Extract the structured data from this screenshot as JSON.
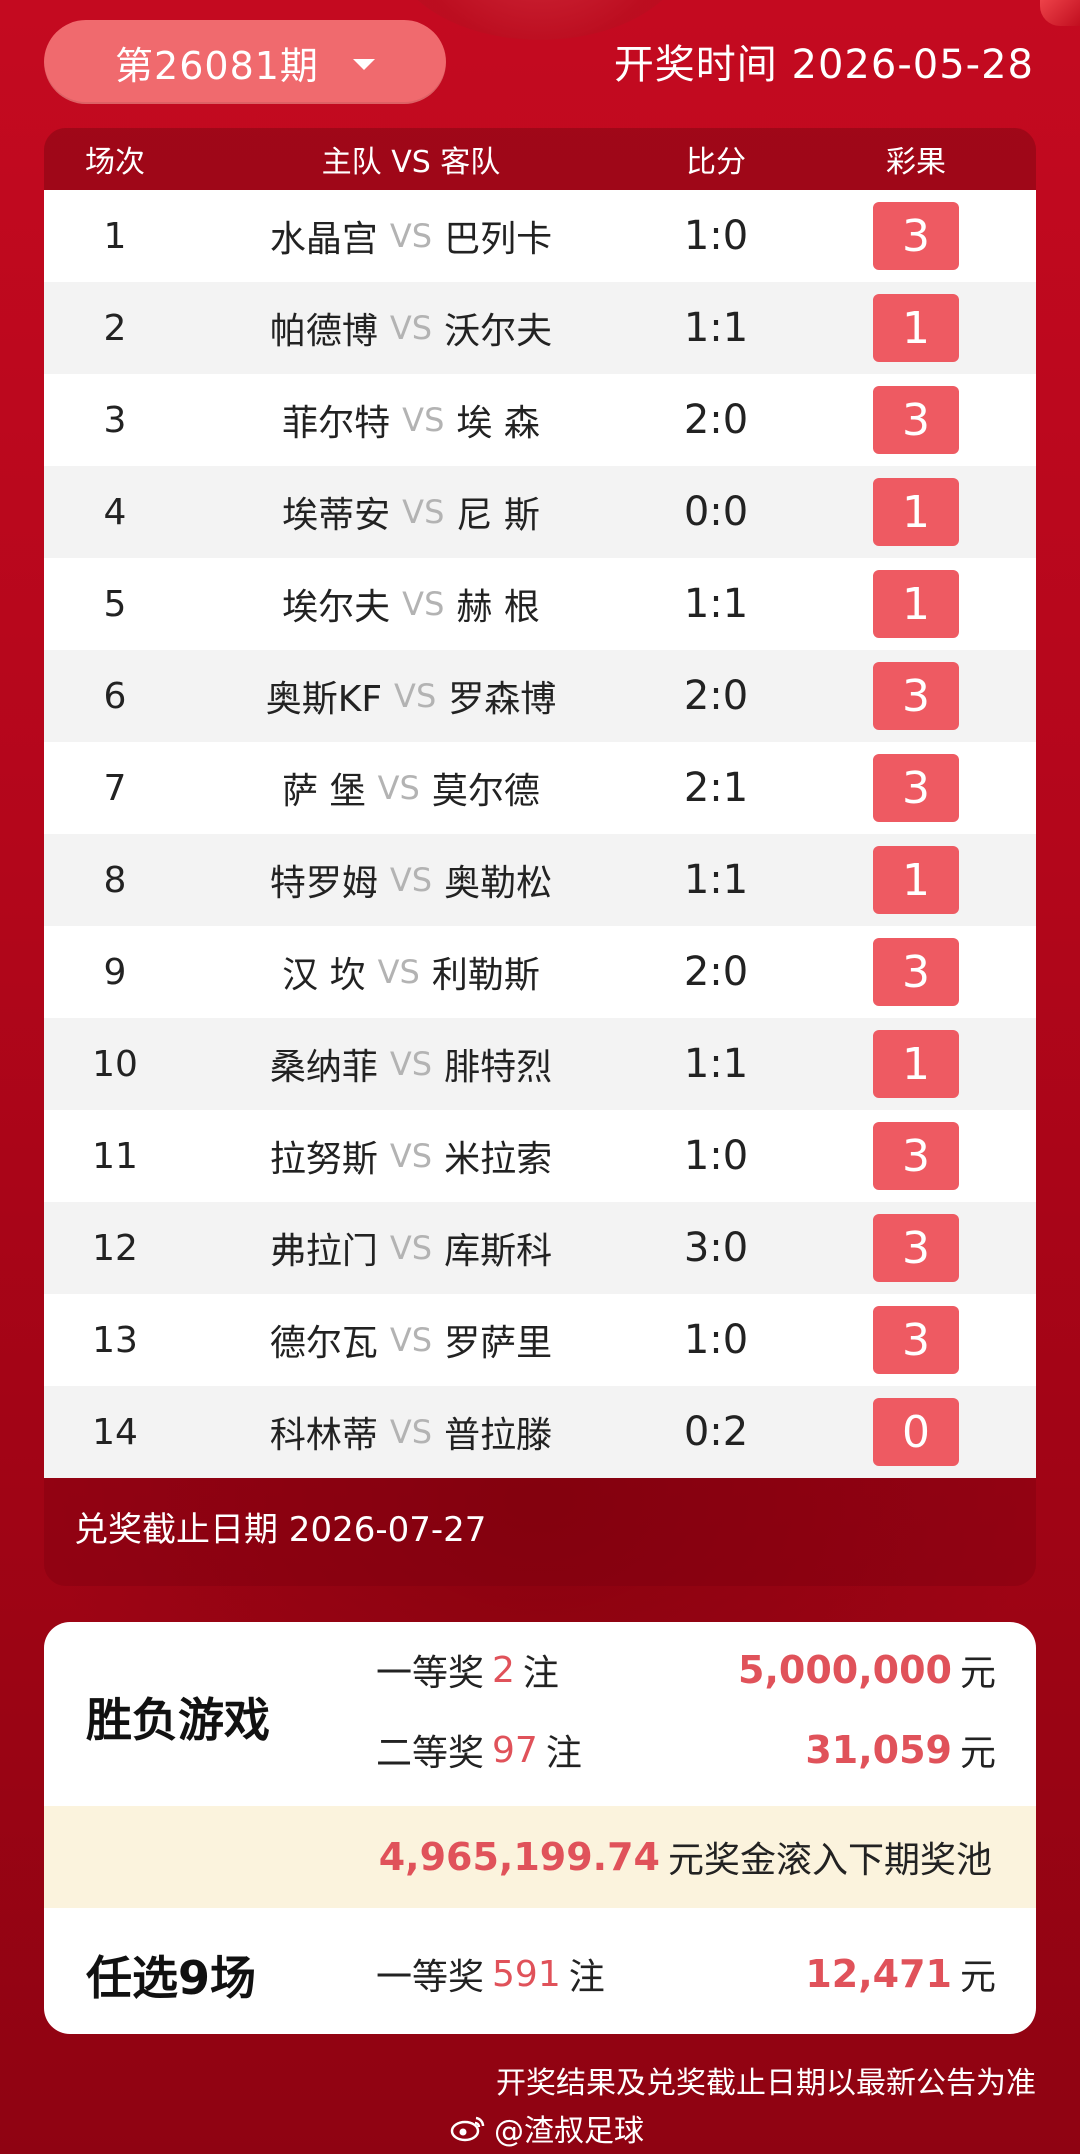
{
  "header": {
    "issue_label": "第26081期",
    "draw_time": "开奖时间 2026-05-28"
  },
  "table": {
    "headers": [
      "场次",
      "主队 VS 客队",
      "比分",
      "彩果"
    ],
    "vs": "VS",
    "rows": [
      {
        "no": "1",
        "home": "水晶宫",
        "away": "巴列卡",
        "score": "1:0",
        "result": "3"
      },
      {
        "no": "2",
        "home": "帕德博",
        "away": "沃尔夫",
        "score": "1:1",
        "result": "1"
      },
      {
        "no": "3",
        "home": "菲尔特",
        "away": "埃 森",
        "score": "2:0",
        "result": "3"
      },
      {
        "no": "4",
        "home": "埃蒂安",
        "away": "尼 斯",
        "score": "0:0",
        "result": "1"
      },
      {
        "no": "5",
        "home": "埃尔夫",
        "away": "赫 根",
        "score": "1:1",
        "result": "1"
      },
      {
        "no": "6",
        "home": "奥斯KF",
        "away": "罗森博",
        "score": "2:0",
        "result": "3"
      },
      {
        "no": "7",
        "home": "萨 堡",
        "away": "莫尔德",
        "score": "2:1",
        "result": "3"
      },
      {
        "no": "8",
        "home": "特罗姆",
        "away": "奥勒松",
        "score": "1:1",
        "result": "1"
      },
      {
        "no": "9",
        "home": "汉 坎",
        "away": "利勒斯",
        "score": "2:0",
        "result": "3"
      },
      {
        "no": "10",
        "home": "桑纳菲",
        "away": "腓特烈",
        "score": "1:1",
        "result": "1"
      },
      {
        "no": "11",
        "home": "拉努斯",
        "away": "米拉索",
        "score": "1:0",
        "result": "3"
      },
      {
        "no": "12",
        "home": "弗拉门",
        "away": "库斯科",
        "score": "3:0",
        "result": "3"
      },
      {
        "no": "13",
        "home": "德尔瓦",
        "away": "罗萨里",
        "score": "1:0",
        "result": "3"
      },
      {
        "no": "14",
        "home": "科林蒂",
        "away": "普拉滕",
        "score": "0:2",
        "result": "0"
      }
    ],
    "deadline": "兑奖截止日期 2026-07-27"
  },
  "prizes": {
    "game1": {
      "name": "胜负游戏",
      "first": {
        "label": "一等奖",
        "count": "2",
        "unit": "注",
        "amount": "5,000,000",
        "currency": "元"
      },
      "second": {
        "label": "二等奖",
        "count": "97",
        "unit": "注",
        "amount": "31,059",
        "currency": "元"
      },
      "rollover_amount": "4,965,199.74",
      "rollover_text": "元奖金滚入下期奖池"
    },
    "game2": {
      "name": "任选9场",
      "first": {
        "label": "一等奖",
        "count": "591",
        "unit": "注",
        "amount": "12,471",
        "currency": "元"
      }
    }
  },
  "footer": {
    "note": "开奖结果及兑奖截止日期以最新公告为准",
    "watermark": "@渣叔足球"
  },
  "colors": {
    "accent": "#ee5a62",
    "background": "#b3061b",
    "rollover_bg": "#fbf3dd"
  }
}
